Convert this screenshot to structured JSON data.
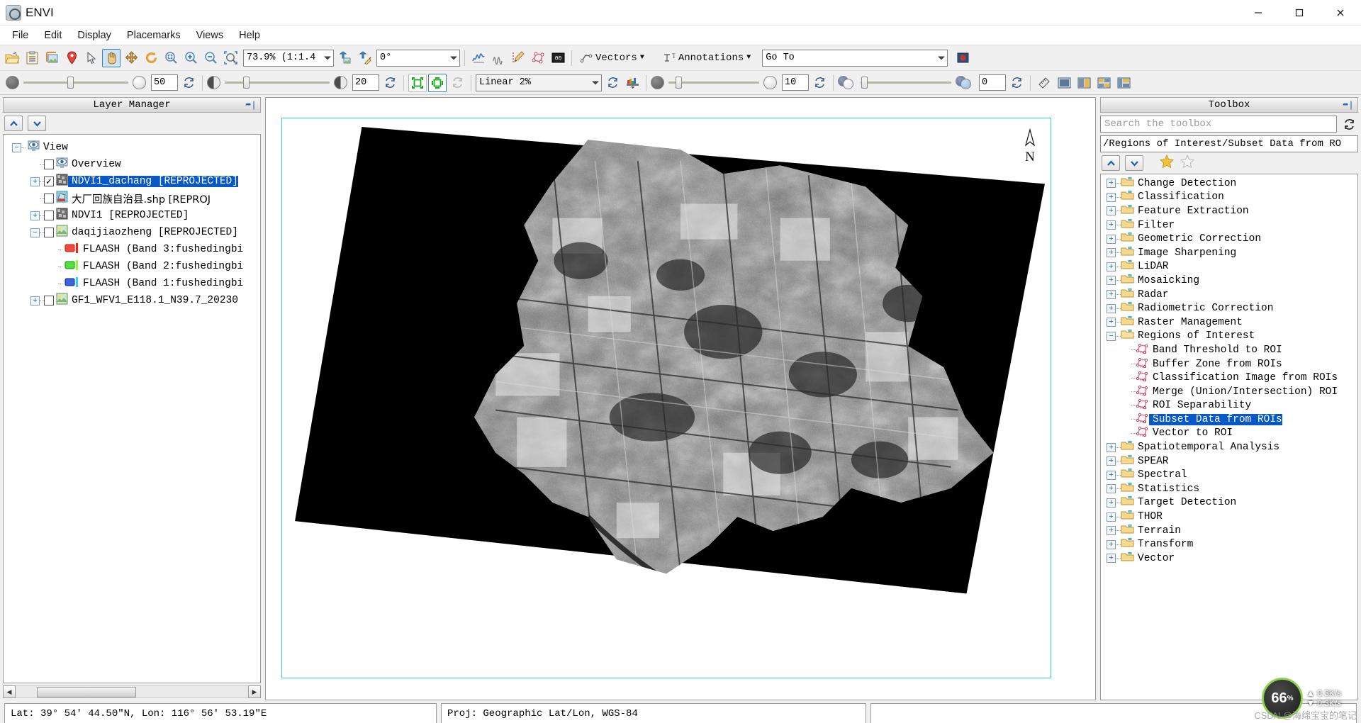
{
  "window": {
    "title": "ENVI",
    "icon": "envi-logo-icon",
    "controls": [
      {
        "name": "minimize",
        "glyph": "─"
      },
      {
        "name": "maximize",
        "glyph": "❐"
      },
      {
        "name": "close",
        "glyph": "✕"
      }
    ]
  },
  "menubar": {
    "items": [
      {
        "name": "file",
        "label": "File"
      },
      {
        "name": "edit",
        "label": "Edit"
      },
      {
        "name": "display",
        "label": "Display"
      },
      {
        "name": "placemarks",
        "label": "Placemarks"
      },
      {
        "name": "views",
        "label": "Views"
      },
      {
        "name": "help",
        "label": "Help"
      }
    ]
  },
  "toolbar_main": {
    "buttons": [
      {
        "name": "open-file-icon",
        "title": "Open"
      },
      {
        "name": "paste-clipboard-icon",
        "title": "Open Remote File"
      },
      {
        "name": "crop-image-icon",
        "title": "Data Manager"
      },
      {
        "name": "placemark-pin-icon",
        "title": "Placemark"
      },
      {
        "name": "select-arrow-icon",
        "title": "Select"
      },
      {
        "name": "pan-hand-icon",
        "title": "Pan",
        "active": true
      },
      {
        "name": "move-crosshair-icon",
        "title": "Fly"
      },
      {
        "name": "rotate-icon",
        "title": "Rotate"
      },
      {
        "name": "zoom-fit-icon",
        "title": "Zoom to Full Extent"
      },
      {
        "name": "zoom-in-icon",
        "title": "Zoom In"
      },
      {
        "name": "zoom-out-icon",
        "title": "Zoom Out"
      },
      {
        "name": "zoom-region-icon",
        "title": "Zoom to Selection"
      }
    ],
    "zoom_combo": {
      "name": "zoom-level-combo",
      "value": "73.9% (1:1.4"
    },
    "after_zoom_buttons": [
      {
        "name": "north-up-icon",
        "title": "Rotate North Up"
      },
      {
        "name": "rotate-custom-icon",
        "title": "Custom Rotation"
      }
    ],
    "rotation_combo": {
      "name": "rotation-combo",
      "value": "0°"
    },
    "profile_buttons": [
      {
        "name": "spectral-profile-icon",
        "title": "Spectral Profile"
      },
      {
        "name": "horizontal-profile-icon",
        "title": "Horizontal Profile"
      },
      {
        "name": "roi-pencil-icon",
        "title": "Region of Interest Tool"
      },
      {
        "name": "vector-edit-icon",
        "title": "Vector Tool"
      },
      {
        "name": "pixel-values-icon",
        "title": "Cursor Value"
      }
    ],
    "vectors_menu": {
      "name": "vectors-menu",
      "label": "Vectors",
      "icon": "vector-polyline-icon"
    },
    "annotations_menu": {
      "name": "annotations-menu",
      "label": "Annotations",
      "icon": "text-annotation-icon"
    },
    "goto_combo": {
      "name": "go-to-combo",
      "value": "Go To"
    },
    "chip_button": {
      "name": "chip-viewer-icon",
      "title": "Chip View"
    }
  },
  "toolbar_display": {
    "transparency": {
      "name": "transparency-slider",
      "value": "50",
      "left_icon": "opacity-dark-icon",
      "right_icon": "opacity-light-icon",
      "percent": 45
    },
    "refresh1": {
      "name": "transparency-reset-icon"
    },
    "brightness": {
      "name": "brightness-slider",
      "value": "20",
      "left_icon": "contrast-icon",
      "right_icon": "contrast-icon",
      "percent": 18
    },
    "refresh2": {
      "name": "brightness-reset-icon"
    },
    "portal_buttons": [
      {
        "name": "portal-square-icon",
        "title": "Portal"
      },
      {
        "name": "portal-link-icon",
        "title": "Linked Portal",
        "active": true
      },
      {
        "name": "portal-reset-icon",
        "title": "Reset",
        "disabled": true
      }
    ],
    "stretch_combo": {
      "name": "stretch-combo",
      "value": "Linear 2%"
    },
    "refresh3": {
      "name": "stretch-reset-icon"
    },
    "histogram_button": {
      "name": "histogram-stretch-icon"
    },
    "sharpen": {
      "name": "sharpen-slider",
      "value": "10",
      "left_icon": "sharpen-dark-icon",
      "right_icon": "sharpen-light-icon",
      "percent": 10
    },
    "refresh4": {
      "name": "sharpen-reset-icon"
    },
    "blend": {
      "name": "blend-slider",
      "value": "0",
      "left_icon": "blend-icon",
      "right_icon": "blend-icon",
      "percent": 2
    },
    "refresh5": {
      "name": "blend-reset-icon"
    },
    "right_buttons": [
      {
        "name": "measure-ruler-icon",
        "title": "Mensuration"
      },
      {
        "name": "view-single-icon",
        "title": "Single View"
      },
      {
        "name": "view-split-icon",
        "title": "Two Views"
      },
      {
        "name": "view-grid-icon",
        "title": "Four Views"
      },
      {
        "name": "view-tile-icon",
        "title": "Tiled Views"
      }
    ]
  },
  "layer_manager": {
    "title": "Layer Manager",
    "pin_icon": "pin-panel-icon",
    "up_button": {
      "name": "move-layer-up-button",
      "icon": "chevron-up-icon"
    },
    "down_button": {
      "name": "move-layer-down-button",
      "icon": "chevron-down-icon"
    },
    "tree": [
      {
        "name": "layer-view-root",
        "label": "View",
        "depth": 0,
        "expander": "minus",
        "checkbox": null,
        "icon": "view-eye-icon",
        "selected": false
      },
      {
        "name": "layer-overview",
        "label": "Overview",
        "depth": 1,
        "expander": "none",
        "checkbox": "unchecked",
        "icon": "overview-eye-icon",
        "selected": false
      },
      {
        "name": "layer-ndvi1-dachang",
        "label": "NDVI1_dachang [REPROJECTED]",
        "depth": 1,
        "expander": "plus",
        "checkbox": "checked",
        "icon": "raster-icon",
        "selected": true
      },
      {
        "name": "layer-dachang-shp",
        "label": "大厂回族自治县.shp [REPROJ",
        "depth": 1,
        "expander": "none",
        "checkbox": "unchecked",
        "icon": "vector-shp-icon",
        "selected": false
      },
      {
        "name": "layer-ndvi1",
        "label": "NDVI1 [REPROJECTED]",
        "depth": 1,
        "expander": "plus",
        "checkbox": "unchecked",
        "icon": "raster-icon",
        "selected": false
      },
      {
        "name": "layer-daqijiaozheng",
        "label": "daqijiaozheng [REPROJECTED]",
        "depth": 1,
        "expander": "minus",
        "checkbox": "unchecked",
        "icon": "rgb-raster-icon",
        "selected": false
      },
      {
        "name": "layer-flaash-band3",
        "label": "FLAASH (Band 3:fushedingbi",
        "depth": 2,
        "expander": "none",
        "checkbox": null,
        "icon": "band-red-icon",
        "selected": false
      },
      {
        "name": "layer-flaash-band2",
        "label": "FLAASH (Band 2:fushedingbi",
        "depth": 2,
        "expander": "none",
        "checkbox": null,
        "icon": "band-green-icon",
        "selected": false
      },
      {
        "name": "layer-flaash-band1",
        "label": "FLAASH (Band 1:fushedingbi",
        "depth": 2,
        "expander": "none",
        "checkbox": null,
        "icon": "band-blue-icon",
        "selected": false
      },
      {
        "name": "layer-gf1-wfv1",
        "label": "GF1_WFV1_E118.1_N39.7_20230",
        "depth": 1,
        "expander": "plus",
        "checkbox": "unchecked",
        "icon": "rgb-raster-icon",
        "selected": false
      }
    ],
    "scrollbar": {
      "name": "layer-horizontal-scrollbar",
      "left_glyph": "◀",
      "right_glyph": "▶"
    }
  },
  "toolbox": {
    "title": "Toolbox",
    "pin_icon": "pin-panel-icon",
    "search": {
      "name": "toolbox-search-input",
      "placeholder": "Search the toolbox",
      "value": ""
    },
    "refresh_icon": "toolbox-refresh-icon",
    "path": "/Regions of Interest/Subset Data from RO",
    "up_button": {
      "name": "toolbox-up-button",
      "icon": "chevron-up-icon"
    },
    "down_button": {
      "name": "toolbox-down-button",
      "icon": "chevron-down-icon"
    },
    "favorite_button": {
      "name": "favorite-star-filled-icon"
    },
    "unfavorite_button": {
      "name": "favorite-star-empty-icon"
    },
    "tree": [
      {
        "name": "toolbox-change-detection",
        "label": "Change Detection",
        "depth": 0,
        "expander": "plus",
        "icon": "folder-icon"
      },
      {
        "name": "toolbox-classification",
        "label": "Classification",
        "depth": 0,
        "expander": "plus",
        "icon": "folder-icon"
      },
      {
        "name": "toolbox-feature-extraction",
        "label": "Feature Extraction",
        "depth": 0,
        "expander": "plus",
        "icon": "folder-icon"
      },
      {
        "name": "toolbox-filter",
        "label": "Filter",
        "depth": 0,
        "expander": "plus",
        "icon": "folder-icon"
      },
      {
        "name": "toolbox-geometric-correction",
        "label": "Geometric Correction",
        "depth": 0,
        "expander": "plus",
        "icon": "folder-icon"
      },
      {
        "name": "toolbox-image-sharpening",
        "label": "Image Sharpening",
        "depth": 0,
        "expander": "plus",
        "icon": "folder-icon"
      },
      {
        "name": "toolbox-lidar",
        "label": "LiDAR",
        "depth": 0,
        "expander": "plus",
        "icon": "folder-icon"
      },
      {
        "name": "toolbox-mosaicking",
        "label": "Mosaicking",
        "depth": 0,
        "expander": "plus",
        "icon": "folder-icon"
      },
      {
        "name": "toolbox-radar",
        "label": "Radar",
        "depth": 0,
        "expander": "plus",
        "icon": "folder-icon"
      },
      {
        "name": "toolbox-radiometric-correction",
        "label": "Radiometric Correction",
        "depth": 0,
        "expander": "plus",
        "icon": "folder-icon"
      },
      {
        "name": "toolbox-raster-management",
        "label": "Raster Management",
        "depth": 0,
        "expander": "plus",
        "icon": "folder-icon"
      },
      {
        "name": "toolbox-regions-of-interest",
        "label": "Regions of Interest",
        "depth": 0,
        "expander": "minus",
        "icon": "folder-open-icon"
      },
      {
        "name": "toolbox-band-threshold-to-roi",
        "label": "Band Threshold to ROI",
        "depth": 1,
        "expander": "none",
        "icon": "roi-tool-icon"
      },
      {
        "name": "toolbox-buffer-zone-from-rois",
        "label": "Buffer Zone from ROIs",
        "depth": 1,
        "expander": "none",
        "icon": "roi-tool-icon"
      },
      {
        "name": "toolbox-classification-image-from-rois",
        "label": "Classification Image from ROIs",
        "depth": 1,
        "expander": "none",
        "icon": "roi-tool-icon"
      },
      {
        "name": "toolbox-merge-rois",
        "label": "Merge (Union/Intersection) ROI",
        "depth": 1,
        "expander": "none",
        "icon": "roi-tool-icon"
      },
      {
        "name": "toolbox-roi-separability",
        "label": "ROI Separability",
        "depth": 1,
        "expander": "none",
        "icon": "roi-tool-icon"
      },
      {
        "name": "toolbox-subset-data-from-rois",
        "label": "Subset Data from ROIs",
        "depth": 1,
        "expander": "none",
        "icon": "roi-tool-icon",
        "selected": true
      },
      {
        "name": "toolbox-vector-to-roi",
        "label": "Vector to ROI",
        "depth": 1,
        "expander": "none",
        "icon": "roi-tool-icon"
      },
      {
        "name": "toolbox-spatiotemporal-analysis",
        "label": "Spatiotemporal Analysis",
        "depth": 0,
        "expander": "plus",
        "icon": "folder-icon"
      },
      {
        "name": "toolbox-spear",
        "label": "SPEAR",
        "depth": 0,
        "expander": "plus",
        "icon": "folder-icon"
      },
      {
        "name": "toolbox-spectral",
        "label": "Spectral",
        "depth": 0,
        "expander": "plus",
        "icon": "folder-icon"
      },
      {
        "name": "toolbox-statistics",
        "label": "Statistics",
        "depth": 0,
        "expander": "plus",
        "icon": "folder-icon"
      },
      {
        "name": "toolbox-target-detection",
        "label": "Target Detection",
        "depth": 0,
        "expander": "plus",
        "icon": "folder-icon"
      },
      {
        "name": "toolbox-thor",
        "label": "THOR",
        "depth": 0,
        "expander": "plus",
        "icon": "folder-icon"
      },
      {
        "name": "toolbox-terrain",
        "label": "Terrain",
        "depth": 0,
        "expander": "plus",
        "icon": "folder-icon"
      },
      {
        "name": "toolbox-transform",
        "label": "Transform",
        "depth": 0,
        "expander": "plus",
        "icon": "folder-icon"
      },
      {
        "name": "toolbox-vector",
        "label": "Vector",
        "depth": 0,
        "expander": "plus",
        "icon": "folder-icon"
      }
    ]
  },
  "view": {
    "compass_label": "N",
    "frame_color": "#2fd2e0",
    "background": "#ffffff"
  },
  "statusbar": {
    "coords": "Lat: 39° 54′ 44.50″N,  Lon: 116° 56′ 53.19″E",
    "projection": "Proj: Geographic Lat/Lon, WGS-84",
    "extra": ""
  },
  "overlay": {
    "net_percent": "66",
    "net_percent_unit": "%",
    "up_rate": "0.3K/s",
    "down_rate": "0.3K/s",
    "watermark": "CSDN @海绵宝宝的笔记"
  }
}
